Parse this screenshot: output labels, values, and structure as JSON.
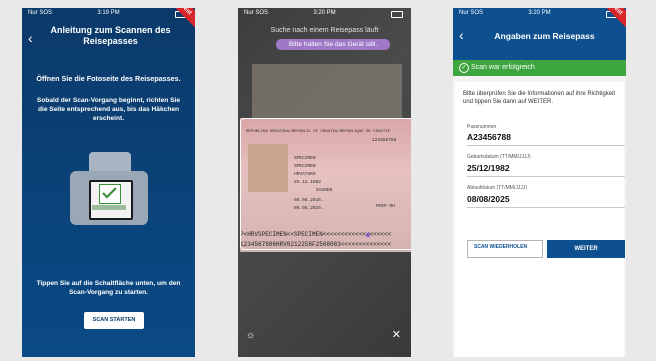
{
  "screen1": {
    "status_left": "Nur SOS",
    "status_time": "3:19 PM",
    "test_label": "Test",
    "title": "Anleitung zum Scannen des Reisepasses",
    "intro": "Öffnen Sie die Fotoseite des Reisepasses.",
    "instruction": "Sobald der Scan-Vorgang beginnt, richten Sie die Seite entsprechend aus, bis das Häkchen erscheint.",
    "illustration_label": "Scan erfolgreich",
    "bottom_text": "Tippen Sie auf die Schaltfläche unten, um den Scan-Vorgang zu starten.",
    "scan_button": "SCAN STARTEN"
  },
  "screen2": {
    "status_left": "Nur SOS",
    "status_time": "3:20 PM",
    "message_top": "Suche nach einem Reisepass läuft",
    "message_hint": "Bitte halten Sie das Gerät still.",
    "passport_header": "REPUBLIKA HRVATSKA/REPUBLIC OF CROATIA/RÉPUBLIQUE DE CROATIE",
    "passport_surname": "SPECIMEN",
    "passport_name": "SPECIMEN",
    "passport_nationality": "HRVATSKO",
    "passport_birthdate": "25.12.1982",
    "passport_place": "ZAGREB",
    "passport_issue": "08.08.2015.",
    "passport_expiry": "08.08.2025.",
    "passport_authority": "MVEP RH",
    "passport_number": "123456788",
    "mrz_line1": "P<HRVSPECIMEN<<SPECIMEN<<<<<<<<<<<<<<<<<<<",
    "mrz_line2": "1234567886HRV8212258F2508083<<<<<<<<<<<<<<"
  },
  "screen3": {
    "status_left": "Nur SOS",
    "status_time": "3:20 PM",
    "test_label": "Test",
    "title": "Angaben zum Reisepass",
    "success": "Scan war erfolgreich",
    "info": "Bitte überprüfen Sie die Informationen auf ihre Richtigkeit und tippen Sie dann auf WEITER.",
    "fields": [
      {
        "label": "Passnummer",
        "value": "A23456788"
      },
      {
        "label": "Geburtsdatum (TT/MM/JJJJ)",
        "value": "25/12/1982"
      },
      {
        "label": "Ablaufdatum (TT/MM/JJJJ)",
        "value": "08/08/2025"
      }
    ],
    "rescan_button": "SCAN WIEDERHOLEN",
    "next_button": "WEITER"
  },
  "colors": {
    "navy": "#0b3a6a",
    "header_blue": "#0d4f8f",
    "success_green": "#3ea63e",
    "test_red": "#d9262a",
    "hint_purple": "#a078c8"
  }
}
